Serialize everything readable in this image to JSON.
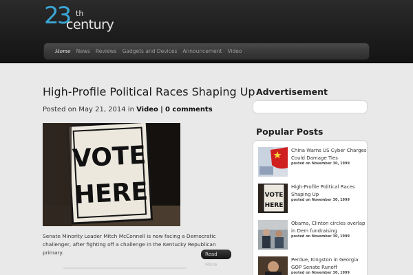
{
  "logo": {
    "number": "23",
    "suffix": "th",
    "word": "century"
  },
  "nav": {
    "items": [
      {
        "label": "Home",
        "active": true
      },
      {
        "label": "News"
      },
      {
        "label": "Reviews"
      },
      {
        "label": "Gadgets and Devices"
      },
      {
        "label": "Announcement"
      },
      {
        "label": "Video"
      }
    ]
  },
  "post": {
    "title": "High-Profile Political Races Shaping Up",
    "meta_prefix": "Posted on May 21, 2014 in",
    "category": "Video",
    "separator": "|",
    "comments": "0 comments",
    "image_sign": {
      "line1": "VOTE",
      "line2": "HERE"
    },
    "excerpt": "Senate Minority Leader Mitch McConnell is now facing a Democratic challenger, after fighting off a challenge in the Kentucky Republican primary.",
    "read_more_label": "Read",
    "read_more_label_2": "More"
  },
  "sidebar": {
    "ad_title": "Advertisement",
    "popular_title": "Popular Posts",
    "popular": [
      {
        "title": "China Warns US Cyber Charges Could Damage Ties",
        "date": "posted on November 30, 1999",
        "thumb": "china-flag-thumbnail"
      },
      {
        "title": "High-Profile Political Races Shaping Up",
        "date": "posted on November 30, 1999",
        "thumb": "vote-here-thumbnail"
      },
      {
        "title": "Obama, Clinton circles overlap in Dem fundraising",
        "date": "posted on November 30, 1999",
        "thumb": "people-office-thumbnail"
      },
      {
        "title": "Perdue, Kingston in Georgia GOP Senate Runoff",
        "date": "posted on November 30, 1999",
        "thumb": "speaker-thumbnail"
      }
    ]
  },
  "colors": {
    "accent": "#3aa6d4",
    "header_bg": "#1c1c1c",
    "page_bg": "#e9e9e9"
  }
}
